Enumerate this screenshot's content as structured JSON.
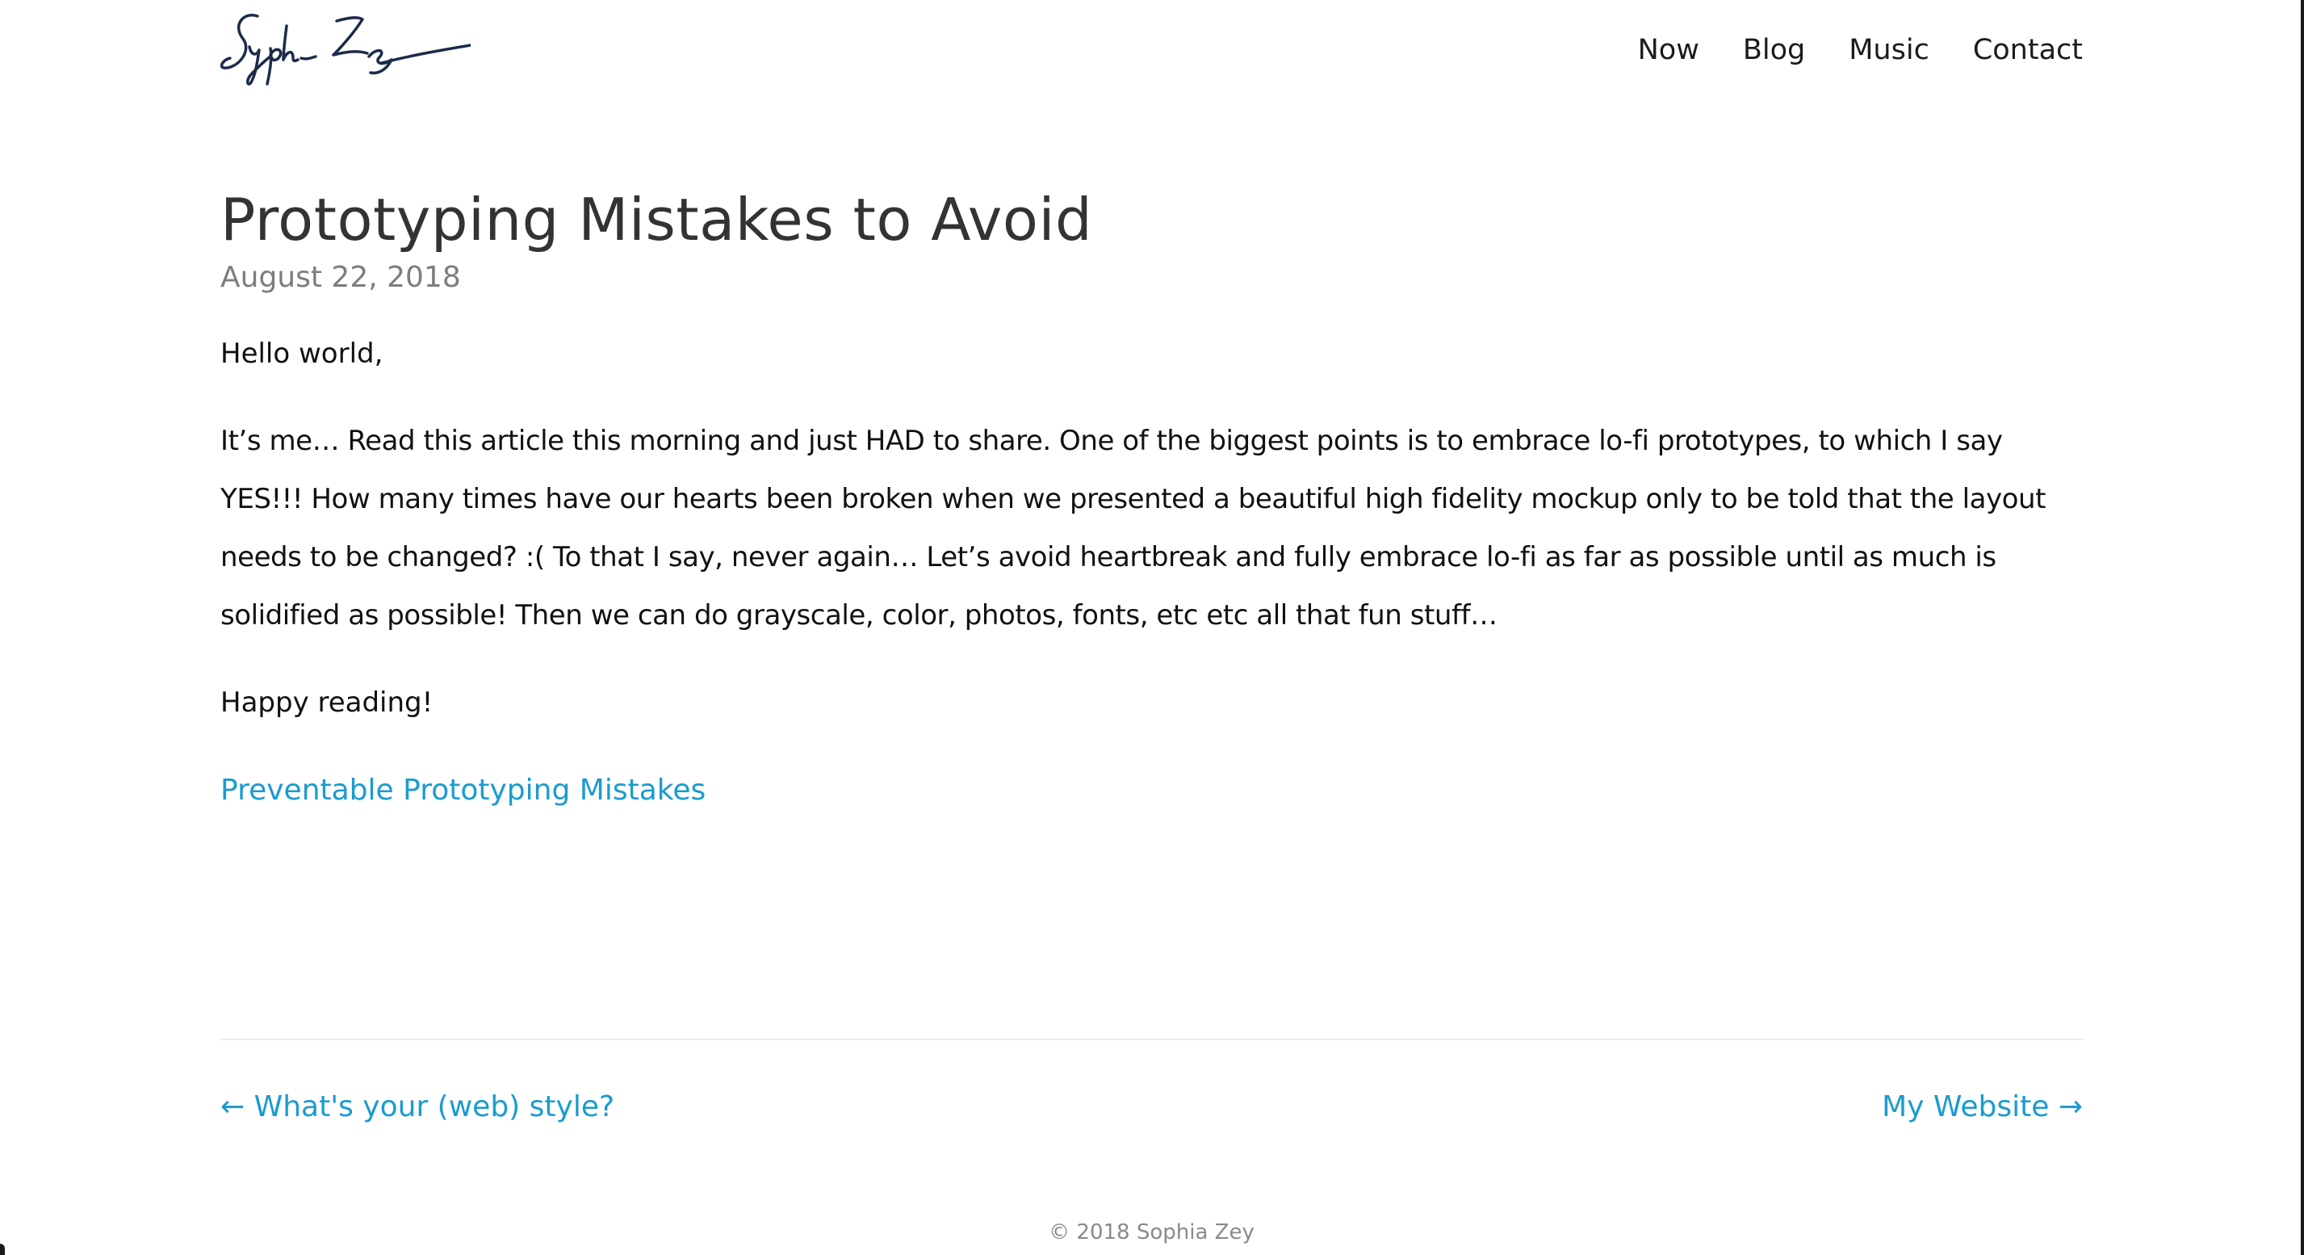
{
  "header": {
    "logo_signature": "Sophia Zey",
    "nav": [
      {
        "label": "Now"
      },
      {
        "label": "Blog"
      },
      {
        "label": "Music"
      },
      {
        "label": "Contact"
      }
    ]
  },
  "post": {
    "title": "Prototyping Mistakes to Avoid",
    "date": "August 22, 2018",
    "paragraphs": [
      "Hello world,",
      "It’s me…  Read this article this morning and just HAD to share.  One of the biggest points is to embrace lo-fi prototypes, to which I say YES!!! How many times have our hearts been broken when we presented a beautiful high fidelity mockup only to be told that the layout needs to be changed? :( To that I say, never again… Let’s avoid heartbreak and fully embrace lo-fi as far as possible until as much is solidified as possible! Then we can do grayscale, color, photos, fonts, etc etc all that fun stuff…",
      "Happy reading!"
    ],
    "link_label": "Preventable Prototyping Mistakes"
  },
  "pager": {
    "prev_label": "← What's your (web) style?",
    "next_label": "My Website →"
  },
  "footer": {
    "copyright": "© 2018 Sophia Zey"
  },
  "colors": {
    "accent": "#1a9bd0",
    "title": "#333333",
    "date": "#7d7d7d",
    "text": "#111111",
    "footer": "#8a8a8a"
  }
}
